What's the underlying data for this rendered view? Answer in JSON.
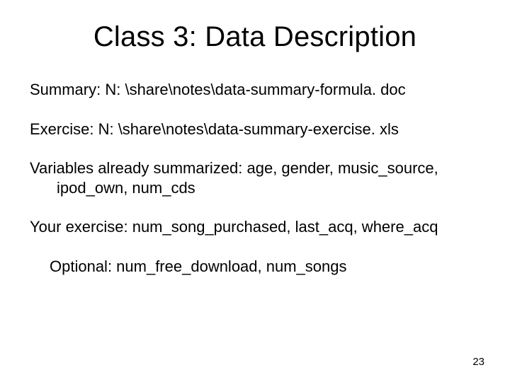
{
  "title": "Class 3: Data Description",
  "lines": {
    "summary": "Summary: N: \\share\\notes\\data-summary-formula. doc",
    "exercise": "Exercise: N: \\share\\notes\\data-summary-exercise. xls",
    "variables_l1": "Variables already summarized: age, gender, music_source,",
    "variables_l2": "ipod_own, num_cds",
    "your_exercise": "Your exercise: num_song_purchased, last_acq, where_acq",
    "optional": "Optional: num_free_download, num_songs"
  },
  "page_number": "23"
}
